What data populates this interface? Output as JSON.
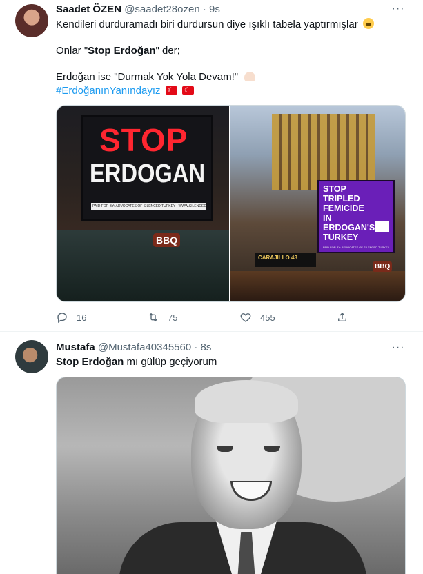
{
  "tweets": [
    {
      "author_name": "Saadet ÖZEN",
      "author_handle": "@saadet28ozen",
      "separator": "·",
      "time": "9s",
      "text_line1": "Kendileri durduramadı biri durdursun diye ışıklı tabela yaptırmışlar",
      "text_line2_pre": "Onlar \"",
      "text_line2_bold": "Stop Erdoğan",
      "text_line2_post": "\" der;",
      "text_line3": "Erdoğan ise \"Durmak Yok Yola Devam!\"",
      "hashtag": "#ErdoğanınYanındayız",
      "media": {
        "left_billboard_word1": "STOP",
        "left_billboard_word2": "ERDOGAN",
        "left_billboard_footer": "PAID FOR BY: ADVOCATES OF SILENCED TURKEY · WWW.SILENCEDTURKEY.ORG",
        "left_sign": "BBQ",
        "right_billboard_text": "STOP TRIPLED FEMICIDE IN ERDOGAN'S TURKEY",
        "right_billboard_footer": "PAID FOR BY: ADVOCATES OF SILENCED TURKEY",
        "right_sign1": "CARAJILLO 43",
        "right_sign2": "BBQ"
      },
      "reply_count": "16",
      "retweet_count": "75",
      "like_count": "455"
    },
    {
      "author_name": "Mustafa",
      "author_handle": "@Mustafa40345560",
      "separator": "·",
      "time": "8s",
      "text_bold": "Stop Erdoğan",
      "text_rest": " mı gülüp geçiyorum"
    }
  ],
  "icons": {
    "more": "more-icon",
    "reply": "reply-icon",
    "retweet": "retweet-icon",
    "like": "heart-icon",
    "share": "share-icon"
  },
  "colors": {
    "accent": "#1d9bf0",
    "text_secondary": "#536471",
    "flag_red": "#e30a17"
  }
}
